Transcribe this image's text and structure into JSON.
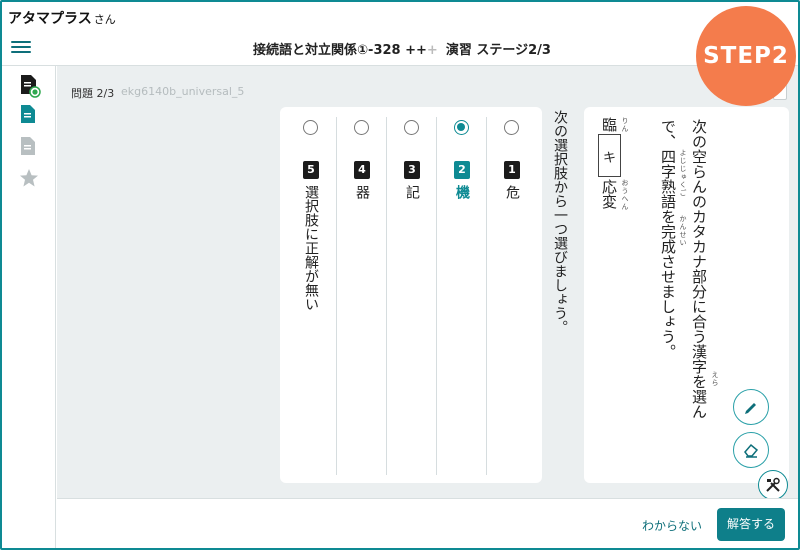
{
  "user": {
    "name": "アタマプラス",
    "suffix": "さん"
  },
  "header": {
    "title_main": "接続語と対立関係①-328 ",
    "title_plus_active": "++",
    "title_plus_dim": "+",
    "title_stage": "演習 ステージ2/3"
  },
  "step_badge": "STEP2",
  "sidebar": {
    "items": [
      "doc-check-icon",
      "document-icon",
      "document-gray-icon",
      "star-icon"
    ]
  },
  "question": {
    "number_label": "問題 2/3",
    "id": "ekg6140b_universal_5",
    "instruction": "次の選択肢から一つ選びましょう。",
    "prompt_line1": "次の空らんのカタカナ部分に合う漢字を選ん",
    "prompt_line2": "で、四字熟語を完成させましょう。",
    "ruby_erabu": "えら",
    "ruby_yojijukugo": "よじじゅくご",
    "ruby_kansei": "かんせい",
    "ruby_rin": "りん",
    "ruby_ouhen": "おうへん",
    "idiom_part1": "臨",
    "idiom_blank": "キ",
    "idiom_part2": "応変"
  },
  "choices": [
    {
      "num": "1",
      "text": "危",
      "selected": false
    },
    {
      "num": "2",
      "text": "機",
      "selected": true
    },
    {
      "num": "3",
      "text": "記",
      "selected": false
    },
    {
      "num": "4",
      "text": "器",
      "selected": false
    },
    {
      "num": "5",
      "text": "選択肢に正解が無い",
      "selected": false
    }
  ],
  "footer": {
    "dont_know": "わからない",
    "answer": "解答する"
  },
  "colors": {
    "accent": "#0e8a93",
    "badge": "#f47c4c",
    "panel_bg": "#ebeff0"
  }
}
